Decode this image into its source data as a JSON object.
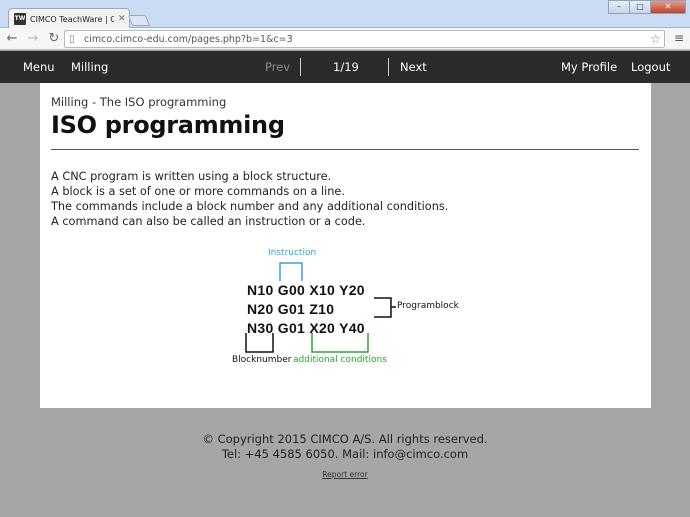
{
  "browser": {
    "tab_title": "CIMCO TeachWare | CIM",
    "tab_icon": "TW",
    "url": "cimco.cimco-edu.com/pages.php?b=1&c=3",
    "win_min": "–",
    "win_max": "□",
    "win_close": "✕"
  },
  "nav": {
    "menu": "Menu",
    "course": "Milling",
    "prev": "Prev",
    "page": "1/19",
    "next": "Next",
    "profile": "My Profile",
    "logout": "Logout"
  },
  "content": {
    "breadcrumb": "Milling - The ISO programming",
    "title": "ISO programming",
    "paragraphs": [
      "A CNC program is written using a block structure.",
      "A block is a set of one or more commands on a line.",
      "The commands include a block number and any additional conditions.",
      "A command can also be called an instruction or a code."
    ]
  },
  "diagram": {
    "code_lines": [
      "N10 G00 X10 Y20",
      "N20 G01 Z10",
      "N30 G01 X20 Y40"
    ],
    "label_instruction": "Instruction",
    "label_programblock": "Programblock",
    "label_blocknumber": "Blocknumber",
    "label_additional": "additional conditions",
    "color_instruction": "#3aa0d8",
    "color_additional": "#2aa832"
  },
  "footer": {
    "copyright": "© Copyright 2015 CIMCO A/S. All rights reserved.",
    "contact": "Tel: +45 4585 6050. Mail: info@cimco.com",
    "report": "Report error"
  }
}
